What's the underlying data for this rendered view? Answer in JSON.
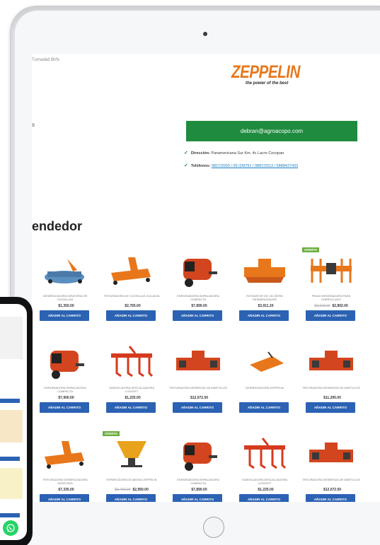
{
  "page": {
    "top_note": "Turnaded Birfs",
    "left_mark": "s"
  },
  "brand": {
    "name": "ZEPPELIN",
    "tagline": "the power of the best"
  },
  "contact": {
    "email_button": "debran@agroacopo.com",
    "address_label": "Dirección:",
    "address_value": "Panamericana Sur Km. 4c Lacre Cocopan",
    "phones_label": "Teléfonos:",
    "phones_value": "0827/2093 / 09 /2/8791 / 0887/2013 / 0888427433"
  },
  "section": {
    "title": "endedor"
  },
  "colors": {
    "brand_orange": "#e8771b",
    "email_green": "#1f8b3e",
    "cart_blue": "#2b62b3",
    "badge_green": "#6cae3e"
  },
  "cart_label": "AÑADIR AL CARRITO",
  "products": [
    {
      "name": "DESBROZADORA GIRATORIA DE CUCHILLAS",
      "price": "$1,350.00",
      "old_price": "",
      "badge": "",
      "icon": "rotary-mower-icon"
    },
    {
      "name": "TRITURADORA DE CUCHILLAS ZULUAGA",
      "price": "$2,765.00",
      "old_price": "",
      "badge": "",
      "icon": "flail-mower-icon"
    },
    {
      "name": "ENFARDADORA EMPACADORA COMPACTA",
      "price": "$7,890.00",
      "old_price": "",
      "badge": "",
      "icon": "baler-icon"
    },
    {
      "name": "ROTAVATOR DE 132 ZERIN DESMENUZADOR",
      "price": "$3,911.20",
      "old_price": "",
      "badge": "",
      "icon": "rotavator-icon"
    },
    {
      "name": "PINZA ENFARDADORA PARA ENRROLLADO",
      "price": "$2,802.00",
      "old_price": "$3,102.00",
      "badge": "OFERTA",
      "icon": "bale-clamp-icon"
    },
    {
      "name": "ENFARDADORA EMPACADORA COMPACTA",
      "price": "$7,900.00",
      "old_price": "",
      "badge": "",
      "icon": "baler-icon"
    },
    {
      "name": "SUBSOLADORA DESCALZADORA LOGIGIFT",
      "price": "$1,225.00",
      "old_price": "",
      "badge": "",
      "icon": "subsoiler-icon"
    },
    {
      "name": "TRITURADORA DESBROZA DE MARTILLOS",
      "price": "$12,072.50",
      "old_price": "",
      "badge": "",
      "icon": "mulcher-icon"
    },
    {
      "name": "DESBROZADORA ZEPPELIN",
      "price": "",
      "old_price": "",
      "badge": "",
      "icon": "slasher-icon"
    },
    {
      "name": "TRITURADORA DESBROZA DE MARTILLOS",
      "price": "$11,295.00",
      "old_price": "",
      "badge": "",
      "icon": "mulcher-icon"
    },
    {
      "name": "TRITURADORA DESBROZADORA GIRATORIA",
      "price": "$7,335.00",
      "old_price": "",
      "badge": "",
      "icon": "flail-mower-icon"
    },
    {
      "name": "ESPARCIDORA DE ABONO ZEPPELIN",
      "price": "$2,950.00",
      "old_price": "$3,400.00",
      "badge": "OFERTA",
      "icon": "spreader-icon"
    },
    {
      "name": "ENFARDADORA EMPACADORA COMPACTA",
      "price": "$7,890.00",
      "old_price": "",
      "badge": "",
      "icon": "baler-icon"
    },
    {
      "name": "SUBSOLADORA DESCALZADORA LOGIGIFT",
      "price": "$1,225.00",
      "old_price": "",
      "badge": "",
      "icon": "subsoiler-icon"
    },
    {
      "name": "TRITURADORA DESBROZA DE MARTILLOS",
      "price": "$12,072.50",
      "old_price": "",
      "badge": "",
      "icon": "mulcher-icon"
    }
  ]
}
